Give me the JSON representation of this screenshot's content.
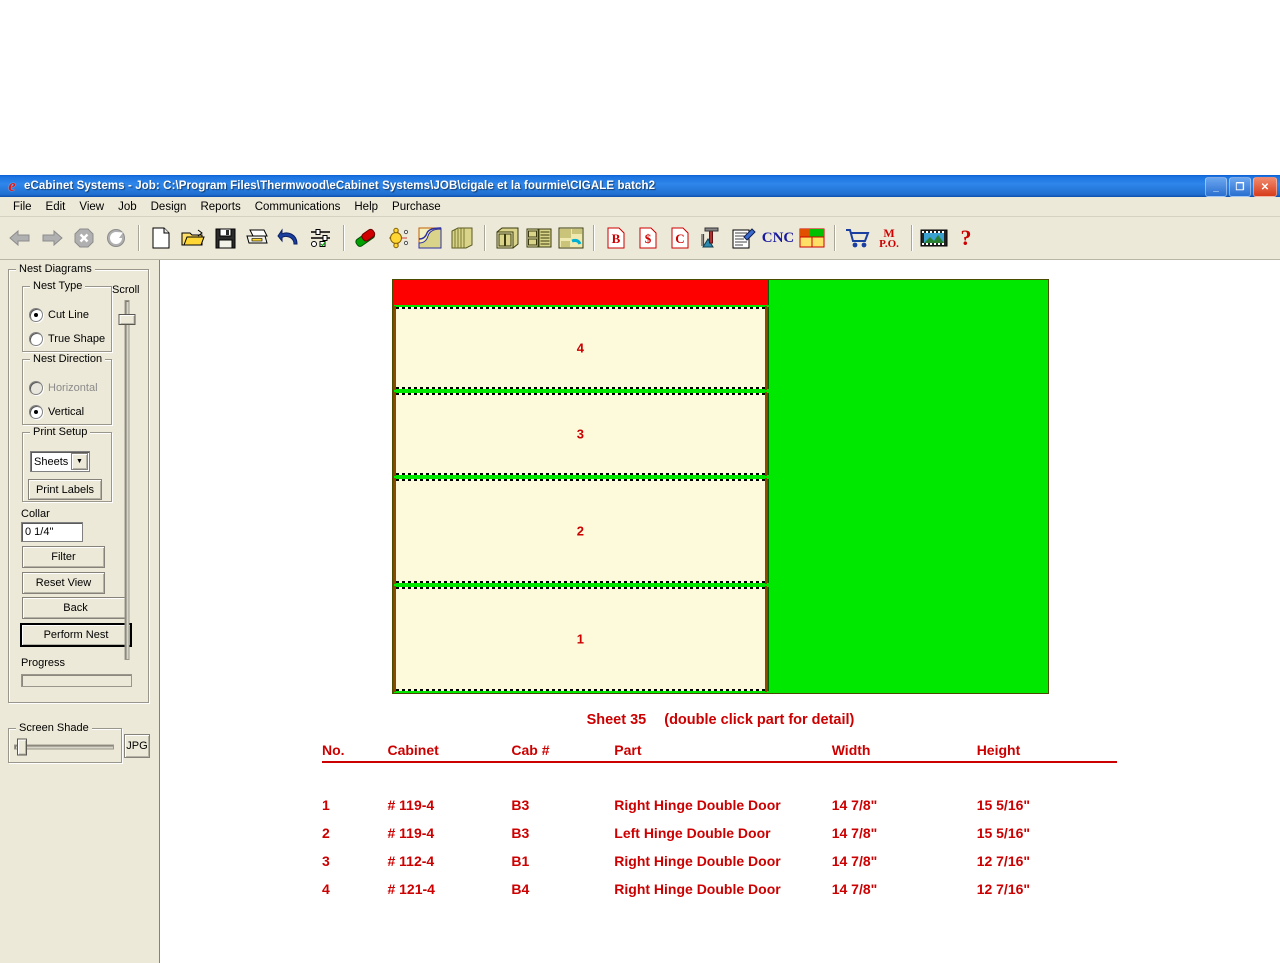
{
  "window": {
    "app_icon": "ecabinet-logo-icon",
    "title": "eCabinet Systems  -  Job: C:\\Program Files\\Thermwood\\eCabinet Systems\\JOB\\cigale et la fourmie\\CIGALE batch2",
    "minimize_label": "_",
    "maximize_label": "❐",
    "close_label": "✕"
  },
  "menubar": {
    "items": [
      {
        "label": "File"
      },
      {
        "label": "Edit"
      },
      {
        "label": "View"
      },
      {
        "label": "Job"
      },
      {
        "label": "Design"
      },
      {
        "label": "Reports"
      },
      {
        "label": "Communications"
      },
      {
        "label": "Help"
      },
      {
        "label": "Purchase"
      }
    ]
  },
  "toolbar": {
    "nav": [
      {
        "name": "back-arrow-icon"
      },
      {
        "name": "forward-arrow-icon"
      },
      {
        "name": "stop-icon"
      },
      {
        "name": "refresh-icon"
      }
    ],
    "file": [
      {
        "name": "new-document-icon"
      },
      {
        "name": "open-folder-icon"
      },
      {
        "name": "save-floppy-icon"
      },
      {
        "name": "print-icon"
      },
      {
        "name": "undo-icon"
      },
      {
        "name": "options-sliders-icon"
      }
    ],
    "design": [
      {
        "name": "materials-icon"
      },
      {
        "name": "hardware-icon"
      },
      {
        "name": "shape-editor-icon"
      },
      {
        "name": "molding-icon"
      }
    ],
    "cabinet": [
      {
        "name": "cabinet-icon"
      },
      {
        "name": "cabinet-list-icon"
      },
      {
        "name": "nesting-icon"
      }
    ],
    "reports": [
      {
        "name": "bid-report-icon",
        "label": "B"
      },
      {
        "name": "cost-report-icon",
        "label": "$"
      },
      {
        "name": "customer-report-icon",
        "label": "C"
      },
      {
        "name": "measure-icon"
      },
      {
        "name": "edit-notes-icon"
      },
      {
        "name": "cnc-icon",
        "label": "CNC"
      },
      {
        "name": "sheet-layout-icon"
      }
    ],
    "commerce": [
      {
        "name": "shopping-cart-icon"
      },
      {
        "name": "purchase-order-icon",
        "label1": "M",
        "label2": "P.O."
      }
    ],
    "misc": [
      {
        "name": "image-strip-icon"
      },
      {
        "name": "help-question-icon",
        "label": "?"
      }
    ]
  },
  "left_panel": {
    "nest_diagrams": {
      "caption": "Nest Diagrams",
      "nest_type": {
        "caption": "Nest Type",
        "options": [
          {
            "label": "Cut Line",
            "selected": true,
            "enabled": true
          },
          {
            "label": "True Shape",
            "selected": false,
            "enabled": true
          }
        ]
      },
      "nest_direction": {
        "caption": "Nest Direction",
        "options": [
          {
            "label": "Horizontal",
            "selected": false,
            "enabled": false
          },
          {
            "label": "Vertical",
            "selected": true,
            "enabled": true
          }
        ]
      },
      "print_setup": {
        "caption": "Print Setup",
        "combo_value": "Sheets",
        "combo_arrow": "▼",
        "print_labels_label": "Print Labels"
      },
      "collar": {
        "label": "Collar",
        "value": "0 1/4\""
      },
      "buttons": [
        {
          "label": "Filter",
          "default": false
        },
        {
          "label": "Reset View",
          "default": false
        },
        {
          "label": "Back",
          "default": false
        },
        {
          "label": "Perform Nest",
          "default": true
        }
      ],
      "progress": {
        "label": "Progress",
        "percent": 0
      }
    },
    "scroll": {
      "label": "Scroll",
      "position_percent": 4
    },
    "screen_shade": {
      "caption": "Screen Shade",
      "position_percent": 3
    },
    "jpg_button": {
      "label": "JPG"
    }
  },
  "nest_diagram": {
    "sheet_caption": "Sheet 35",
    "hint": "(double click part for detail)",
    "waste_color": "#00e800",
    "offcut_color": "#ff0000",
    "part_fill_color": "#fcfadb",
    "parts": [
      {
        "number": "4",
        "height_frac": 0.2215
      },
      {
        "number": "3",
        "height_frac": 0.2215
      },
      {
        "number": "2",
        "height_frac": 0.2785
      },
      {
        "number": "1",
        "height_frac": 0.2785
      }
    ]
  },
  "parts_table": {
    "headers": {
      "no": "No.",
      "cabinet": "Cabinet",
      "cab_num": "Cab #",
      "part": "Part",
      "width": "Width",
      "height": "Height"
    },
    "rows": [
      {
        "no": "1",
        "cabinet": "# 119-4",
        "cab_num": "B3",
        "part": "Right Hinge Double Door",
        "width": "14 7/8\"",
        "height": "15 5/16\""
      },
      {
        "no": "2",
        "cabinet": "# 119-4",
        "cab_num": "B3",
        "part": "Left Hinge Double Door",
        "width": "14 7/8\"",
        "height": "15 5/16\""
      },
      {
        "no": "3",
        "cabinet": "# 112-4",
        "cab_num": "B1",
        "part": "Right Hinge Double Door",
        "width": "14 7/8\"",
        "height": "12 7/16\""
      },
      {
        "no": "4",
        "cabinet": "# 121-4",
        "cab_num": "B4",
        "part": "Right Hinge Double Door",
        "width": "14 7/8\"",
        "height": "12 7/16\""
      }
    ]
  },
  "colors": {
    "text_red": "#cc0000",
    "titlebar_blue": "#1a73e0",
    "window_face": "#ece9d8"
  }
}
